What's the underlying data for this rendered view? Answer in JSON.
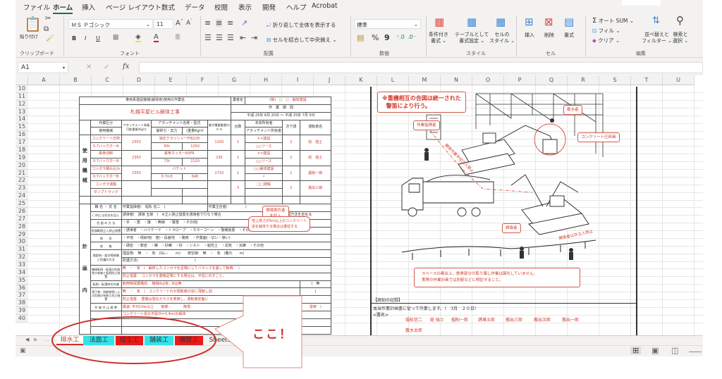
{
  "menu": [
    "ファイル",
    "ホーム",
    "挿入",
    "ページ レイアウト",
    "数式",
    "データ",
    "校閲",
    "表示",
    "開発",
    "ヘルプ",
    "Acrobat"
  ],
  "ribbon": {
    "clipboard": {
      "paste": "貼り付け",
      "label": "クリップボード"
    },
    "font": {
      "name": "ＭＳ Ｐゴシック",
      "size": "11",
      "bold": "B",
      "italic": "I",
      "underline": "U",
      "label": "フォント"
    },
    "alignment": {
      "wrap": "折り返して全体を表示する",
      "merge": "セルを結合して中央揃え",
      "label": "配置"
    },
    "number": {
      "format": "標準",
      "percent": "%",
      "comma": "9",
      "label": "数値"
    },
    "styles": {
      "conditional": [
        "条件付き",
        "書式"
      ],
      "table": [
        "テーブルとして",
        "書式設定"
      ],
      "cell": [
        "セルの",
        "スタイル"
      ],
      "label": "スタイル"
    },
    "cells": {
      "insert": "挿入",
      "delete": "削除",
      "format": "書式",
      "label": "セル"
    },
    "editing": {
      "autosum": "オート SUM",
      "fill": "フィル",
      "clear": "クリア",
      "sort": [
        "並べ替えと",
        "フィルター"
      ],
      "find": [
        "検索と",
        "選択"
      ],
      "label": "編集"
    }
  },
  "formula_bar": {
    "name_box": "A1",
    "value": ""
  },
  "columns": [
    "A",
    "B",
    "C",
    "D",
    "E",
    "F",
    "G",
    "H",
    "I",
    "J",
    "K",
    "L",
    "M",
    "N",
    "O",
    "P",
    "Q",
    "R",
    "S",
    "T",
    "U"
  ],
  "rows": [
    "10",
    "11",
    "12",
    "13",
    "14",
    "15",
    "16",
    "17",
    "18",
    "19",
    "20",
    "21",
    "22",
    "23",
    "24",
    "25",
    "26",
    "27",
    "28",
    "29",
    "30",
    "31",
    "32",
    "33",
    "34",
    "35",
    "36",
    "37",
    "38",
    "39",
    "40"
  ],
  "form": {
    "work_name_label": "車両系建設機械(解体用)使用の作業名",
    "work_name": "札幌平屋ビル解体工事",
    "company_label": "業者名",
    "company": "(株)　○　○　解体建設",
    "period_label": "作　業　期　間",
    "period": "平成 25年 6月 20日 ～ 平成 25年 7月 5日",
    "headers": {
      "category": "作業区分",
      "machine": "使用機械",
      "attach_weight": "アタッチメント装着可能重量(Kg)①",
      "attach_name": "アタッチメント名称・型式",
      "force": "破砕力・剪力",
      "weight": "(重量Kg)②",
      "max_load": "最大積載重量(t) ①-②",
      "count": "台数",
      "owner": "本体所有者",
      "attach_owner": "アタッチメント所有者",
      "sub": "次下請",
      "operator": "運転者名"
    },
    "section_machines": "使用機械",
    "machines": [
      {
        "work": "コンクリート圧砕",
        "machine": "0.7バックホーA",
        "attach_weight": "2350",
        "attach": "油圧クラッシャーFHJ120",
        "force": "65t",
        "weight": "1250",
        "max": "1100",
        "count": "1",
        "owner": "××建設",
        "attach_owner": "△△リース",
        "sub": "2",
        "operator": "総　強士"
      },
      {
        "work": "鉄骨切断",
        "machine": "0.7バックホーA",
        "attach_weight": "2350",
        "attach": "鉄骨カッター60FR",
        "force": "73t",
        "weight": "2120",
        "max": "230",
        "count": "1",
        "owner": "××建設",
        "attach_owner": "△△リース",
        "sub": "2",
        "operator": "総　強士"
      },
      {
        "work": "コンガラ積み込み",
        "machine": "0.7バックホーB",
        "attach_weight": "2350",
        "attach": "バケット",
        "force": "0.7m3",
        "weight": "640",
        "max": "1710",
        "count": "1",
        "owner": "○○解体建設",
        "attach_owner": "〃",
        "sub": "1",
        "operator": "掘削一郎"
      },
      {
        "work": "コンガラ運搬",
        "machine": "ダンプトラック",
        "attach_weight": "",
        "attach": "",
        "force": "",
        "weight": "",
        "max": "",
        "count": "3",
        "owner": "□□運輸",
        "attach_owner": "",
        "sub": "2",
        "operator": "搬出三郎"
      }
    ],
    "section_plan": [
      "計",
      "画",
      "内"
    ],
    "plan": {
      "staff_label": "職 名 ・ 氏 名",
      "staff_note": "( )内には氏名を記入",
      "commander": "作業指揮者(　堀松 信二　)",
      "chief": "作業主任者(　　　　　)",
      "guide": "誘導者(　誘導 五郎　)　※立入禁止措置を誘導者で行なう場合",
      "signal_rule": "合図方法を定める",
      "signal_label": "合 図 の 方 法",
      "signal": "・手　・笛　・旗　・無線　・警笛　・その他(",
      "danger_label": "危険範囲立入禁止措置",
      "danger": "・誘導者　・バリケード　・トラロープ　・カラーコーン　・警報装置　・その他",
      "terrain_label": "地　　形",
      "terrain": "・平地　・傾斜地(　度)・段差地　・路肩　・作業面(・広い・狭い)",
      "soil_label": "地　　質",
      "soil": "・硬岩　・軟岩　・礫　・砂礫　・砂　・シルト　・粘性土　・泥炭　・瓦礫　・その他",
      "buried_label": "埋設物・架空線接触と防護の方法",
      "buried": "埋設物:　無　・　有　(GL－　　m)　　架空線:　無　・　有　(離れ　　m)",
      "protect": "防護方法(　　　　　　　　　　　　　　　　)",
      "overturn_label": "機械転倒・転落の危険性の有無と転倒防止措置",
      "overturn": "無　・　有　(　解体したコンガラを足場にしてバランスを崩して転倒。　)",
      "overturn_prev": "防止措置:　コンガラを重機足場にする場合は、平坦に均すこと。",
      "fall_work_label": "転倒・転落時の作業",
      "fall_work": "転倒時保護構造:　機械Aは有、Bは無",
      "fall_work_end": "(　無",
      "debris_label": "落下物・飛散物等による危険の有無と防止措置",
      "debris": "無　・　有　(　コンクリート片が運転席の窓に飛散し割",
      "debris_end": ")",
      "debris_prev": "防止措置:　重機は強化ガラスを使用し、運転席前面に",
      "stop_label": "作 業 中 止 基 準",
      "stop": "風速: 平均10m以上　　雨量:　　　　降雪:",
      "stop_end": "雷時　)",
      "note40": "コンクリート造の平屋(H=3.4m)の解体"
    },
    "callout_manager": [
      "現場責任者",
      "を記入"
    ],
    "callout_chief": [
      "地上高さが5m以上のコンクリート",
      "造を解体する場合は選任する"
    ]
  },
  "illustration": {
    "title": [
      "※重機相互の合図は統一された",
      "警笛により行う。"
    ],
    "labels": {
      "commander": "作業指揮者",
      "water": "散水者",
      "crusher": "コンクリート圧砕具",
      "guide": "誘導者",
      "no_entry_work": "解体作業半径立入禁止",
      "no_entry_public": "関係者以外立入禁止"
    },
    "scroll_note": [
      "スペースの都合上、鉄骨部分の取り壊し作業は図化していません。",
      "実際の作業計画では別紙などに明記すること。"
    ],
    "notice_title": "【周知の記録】",
    "notice_text": "本当作業計画書に従って作業します。（　3月　２０日）",
    "sign_label": "<署名>",
    "signatures": [
      "堀松信二",
      "総 強士",
      "掘削一郎",
      "誘導五郎",
      "搬出三郎",
      "搬出次郎",
      "搬出一郎",
      "散水太郎"
    ]
  },
  "sheet_tabs": [
    {
      "name": "排水工",
      "color": "#ffffff"
    },
    {
      "name": "法面工",
      "color": "#33e3ea"
    },
    {
      "name": "植生工",
      "color": "#e81a1a"
    },
    {
      "name": "舗装工",
      "color": "#33e3ea"
    },
    {
      "name": "擁壁工",
      "color": "#e81a1a"
    },
    {
      "name": "Sheet1",
      "color": "#f3f2f1"
    }
  ],
  "annotation": {
    "text": "ここ！",
    "color": "#d0302a"
  }
}
